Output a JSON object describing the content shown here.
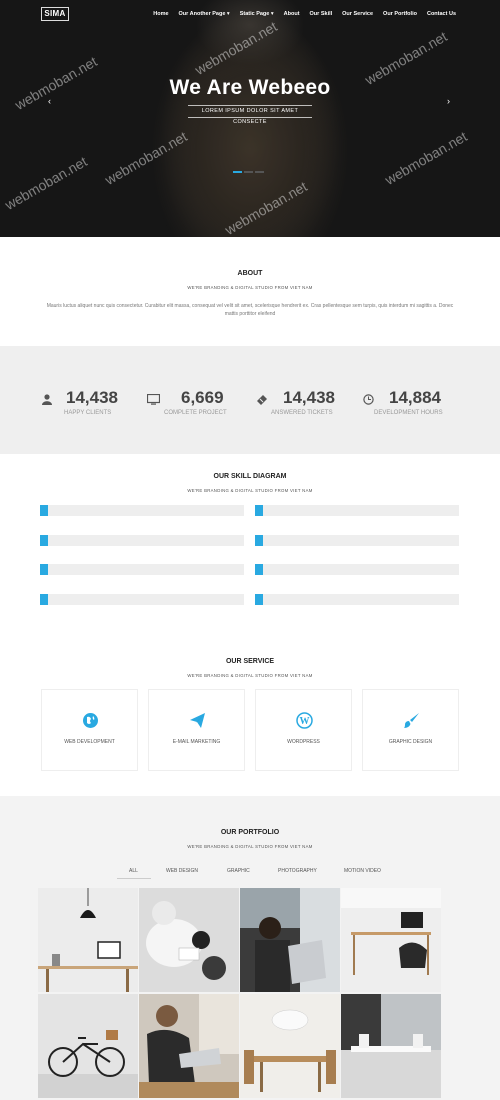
{
  "nav": {
    "logo": "SIMA",
    "items": [
      "Home",
      "Our Another Page",
      "Static Page",
      "About",
      "Our Skill",
      "Our Service",
      "Our Portfolio",
      "Contact Us"
    ]
  },
  "hero": {
    "title": "We Are Webeeo",
    "subtitle": "LOREM IPSUM DOLOR SIT AMET CONSECTE",
    "watermark": "webmoban.net"
  },
  "about": {
    "title": "ABOUT",
    "subtitle": "WE'RE BRANDING & DIGITAL STUDIO FROM VIET NAM",
    "text": "Mauris luctus aliquet nunc quis consectetur. Curabitur elit massa, consequat vel velit sit amet, scelerisque hendrerit ex. Cras pellentesque sem turpis, quis interdum mi sagittis a. Donec mattis porttitor eleifend"
  },
  "counters": [
    {
      "icon": "user-icon",
      "value": "14,438",
      "label": "HAPPY CLIENTS"
    },
    {
      "icon": "monitor-icon",
      "value": "6,669",
      "label": "COMPLETE PROJECT"
    },
    {
      "icon": "ticket-icon",
      "value": "14,438",
      "label": "ANSWERED TICKETS"
    },
    {
      "icon": "clock-icon",
      "value": "14,884",
      "label": "DEVELOPMENT HOURS"
    }
  ],
  "skills": {
    "title": "OUR SKILL DIAGRAM",
    "subtitle": "WE'RE BRANDING & DIGITAL STUDIO FROM VIET NAM",
    "accent": "#29a9e1"
  },
  "service": {
    "title": "OUR SERVICE",
    "subtitle": "WE'RE BRANDING & DIGITAL STUDIO FROM VIET NAM",
    "items": [
      {
        "icon": "globe-icon",
        "label": "WEB DEVELOPMENT"
      },
      {
        "icon": "paper-plane-icon",
        "label": "E-MAIL MARKETING"
      },
      {
        "icon": "wordpress-icon",
        "label": "WORDPRESS"
      },
      {
        "icon": "paint-brush-icon",
        "label": "GRAPHIC DESIGN"
      }
    ]
  },
  "portfolio": {
    "title": "OUR PORTFOLIO",
    "subtitle": "WE'RE BRANDING & DIGITAL STUDIO FROM VIET NAM",
    "filters": [
      "ALL",
      "WEB DESIGN",
      "GRAPHIC",
      "PHOTOGRAPHY",
      "MOTION VIDEO"
    ],
    "active_filter": "ALL"
  }
}
